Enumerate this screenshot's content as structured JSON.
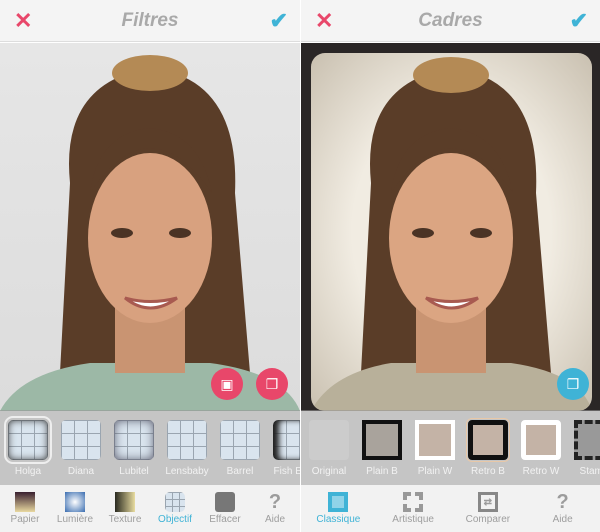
{
  "left": {
    "title": "Filtres",
    "filters": [
      {
        "label": "Holga",
        "selected": true
      },
      {
        "label": "Diana"
      },
      {
        "label": "Lubitel"
      },
      {
        "label": "Lensbaby"
      },
      {
        "label": "Barrel"
      },
      {
        "label": "Fish Eye"
      }
    ],
    "tools": [
      {
        "label": "Papier",
        "icon": "paper-icon"
      },
      {
        "label": "Lumière",
        "icon": "light-icon"
      },
      {
        "label": "Texture",
        "icon": "texture-icon"
      },
      {
        "label": "Objectif",
        "icon": "lens-icon",
        "active": true
      },
      {
        "label": "Effacer",
        "icon": "eraser-icon"
      },
      {
        "label": "Aide",
        "icon": "help-icon"
      }
    ]
  },
  "right": {
    "title": "Cadres",
    "frames": [
      {
        "label": "Original"
      },
      {
        "label": "Plain B"
      },
      {
        "label": "Plain W"
      },
      {
        "label": "Retro B",
        "selected": true
      },
      {
        "label": "Retro W"
      },
      {
        "label": "Stamp"
      }
    ],
    "tools": [
      {
        "label": "Classique",
        "icon": "classic-frame-icon",
        "active": true
      },
      {
        "label": "Artistique",
        "icon": "artistic-frame-icon"
      },
      {
        "label": "Comparer",
        "icon": "compare-icon"
      },
      {
        "label": "Aide",
        "icon": "help-icon"
      }
    ]
  },
  "icons": {
    "close": "✕",
    "check": "✔",
    "help": "?"
  },
  "colors": {
    "accent": "#3fb3d6",
    "close": "#e8476a"
  }
}
